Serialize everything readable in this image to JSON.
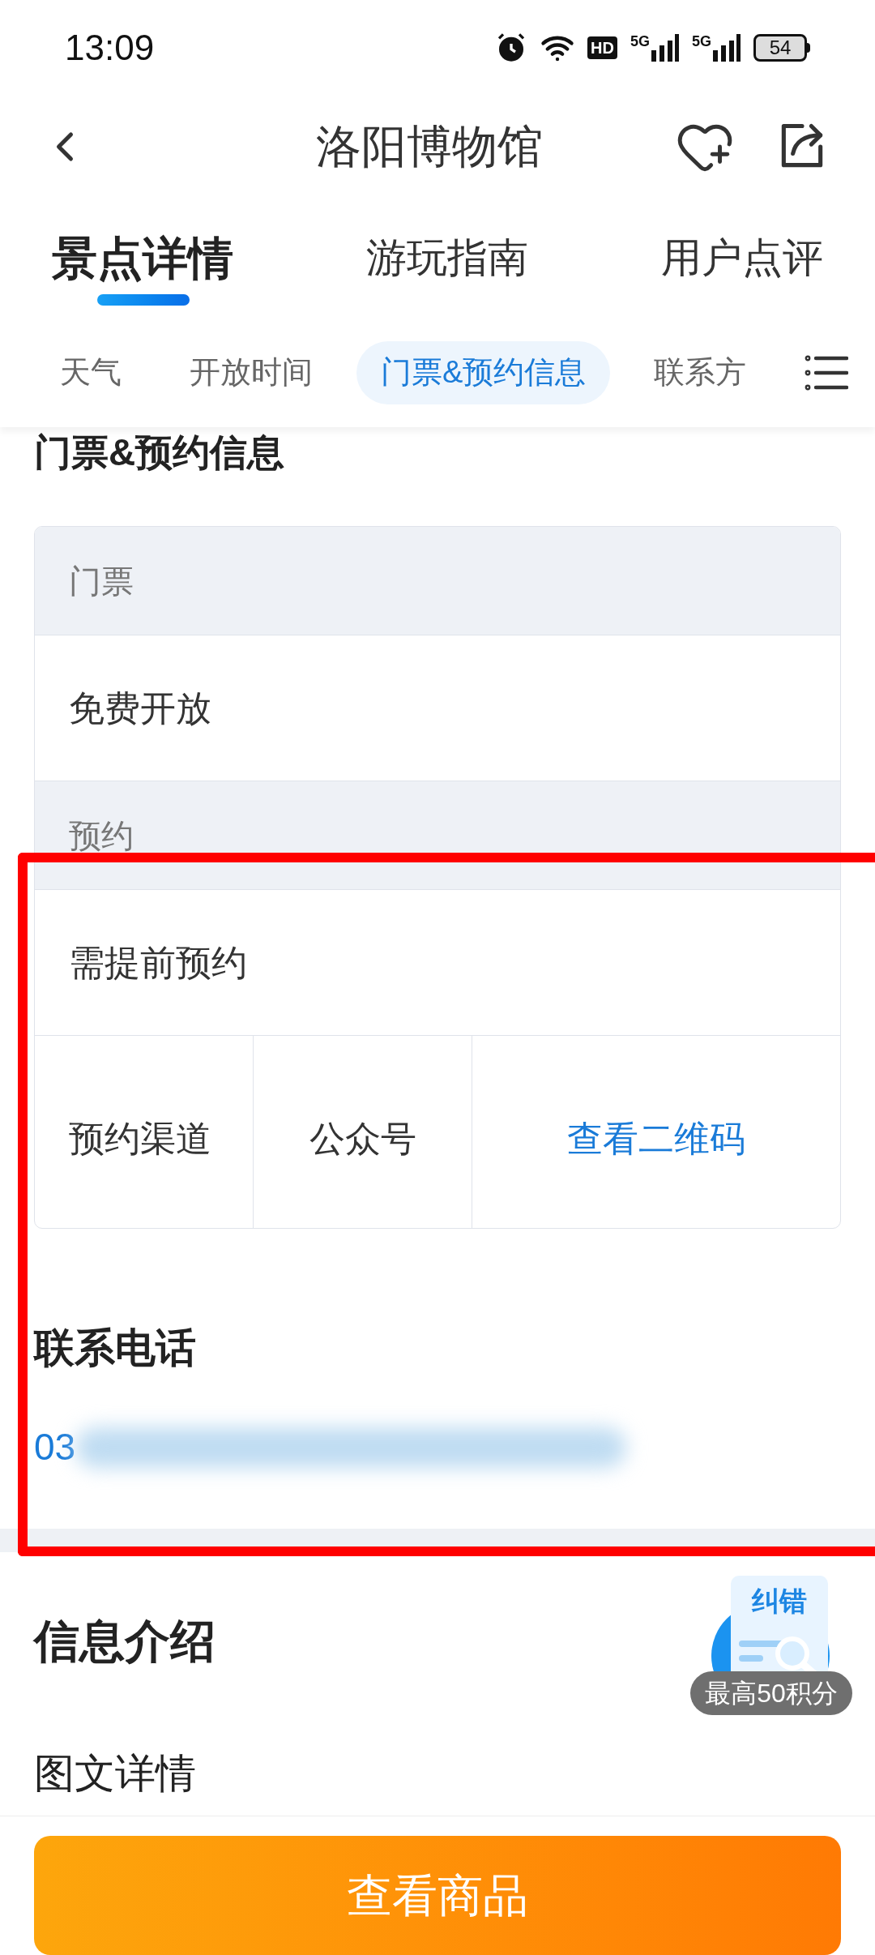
{
  "status_bar": {
    "time": "13:09",
    "hd_label": "HD",
    "network_labels": [
      "5G",
      "5G"
    ],
    "battery": "54"
  },
  "nav": {
    "title": "洛阳博物馆"
  },
  "tabs": [
    {
      "label": "景点详情",
      "selected": true
    },
    {
      "label": "游玩指南",
      "selected": false
    },
    {
      "label": "用户点评",
      "selected": false
    }
  ],
  "chips": [
    {
      "label": "天气",
      "selected": false
    },
    {
      "label": "开放时间",
      "selected": false
    },
    {
      "label": "门票&预约信息",
      "selected": true
    },
    {
      "label": "联系方",
      "selected": false
    }
  ],
  "section_heading": "门票&预约信息",
  "table": {
    "rows": [
      {
        "kind": "header",
        "cells": [
          {
            "text": "门票"
          }
        ]
      },
      {
        "kind": "value",
        "cells": [
          {
            "text": "免费开放"
          }
        ]
      },
      {
        "kind": "header",
        "cells": [
          {
            "text": "预约"
          }
        ]
      },
      {
        "kind": "value",
        "cells": [
          {
            "text": "需提前预约"
          }
        ]
      },
      {
        "kind": "split",
        "cells": [
          {
            "text": "预约渠道",
            "link": false
          },
          {
            "text": "公众号",
            "link": false
          },
          {
            "text": "查看二维码",
            "link": true
          }
        ]
      }
    ]
  },
  "contact": {
    "heading": "联系电话",
    "phone": "03"
  },
  "intro": {
    "heading": "信息介绍",
    "subheading": "图文详情"
  },
  "feedback_badge": {
    "icon_label": "纠错",
    "caption": "最高50积分"
  },
  "bottom_button": {
    "label": "查看商品"
  }
}
